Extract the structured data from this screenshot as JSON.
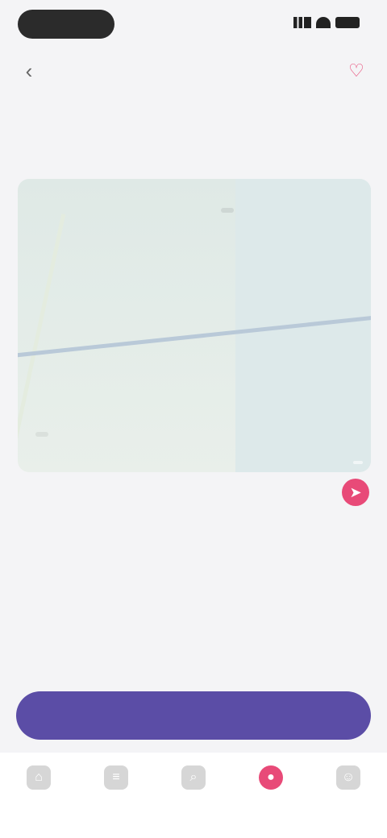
{
  "status_bar": {
    "time": "",
    "icons": [
      "signal-icon",
      "wifi-icon",
      "battery-icon"
    ]
  },
  "header": {
    "title": "",
    "back_icon": "chevron-left-icon",
    "action_icon": "heart-icon"
  },
  "tabs": [
    {
      "label": "",
      "active": true
    },
    {
      "label": ""
    },
    {
      "label": ""
    },
    {
      "label": ""
    },
    {
      "label": ""
    }
  ],
  "section": {
    "title": ""
  },
  "map": {
    "label_top": "",
    "label_bottom": "",
    "credit": ""
  },
  "location": {
    "name": "",
    "address": "",
    "distance": "",
    "nav_icon": "navigation-icon"
  },
  "cta": {
    "label": ""
  },
  "bottom_nav": [
    {
      "label": "",
      "icon": "home-icon"
    },
    {
      "label": "",
      "icon": "list-icon"
    },
    {
      "label": "",
      "icon": "search-icon"
    },
    {
      "label": "",
      "icon": "location-pin-icon",
      "active": true
    },
    {
      "label": "",
      "icon": "profile-icon"
    }
  ],
  "colors": {
    "accent": "#e84a78",
    "primary": "#5b4da6",
    "background": "#f4f4f6"
  }
}
